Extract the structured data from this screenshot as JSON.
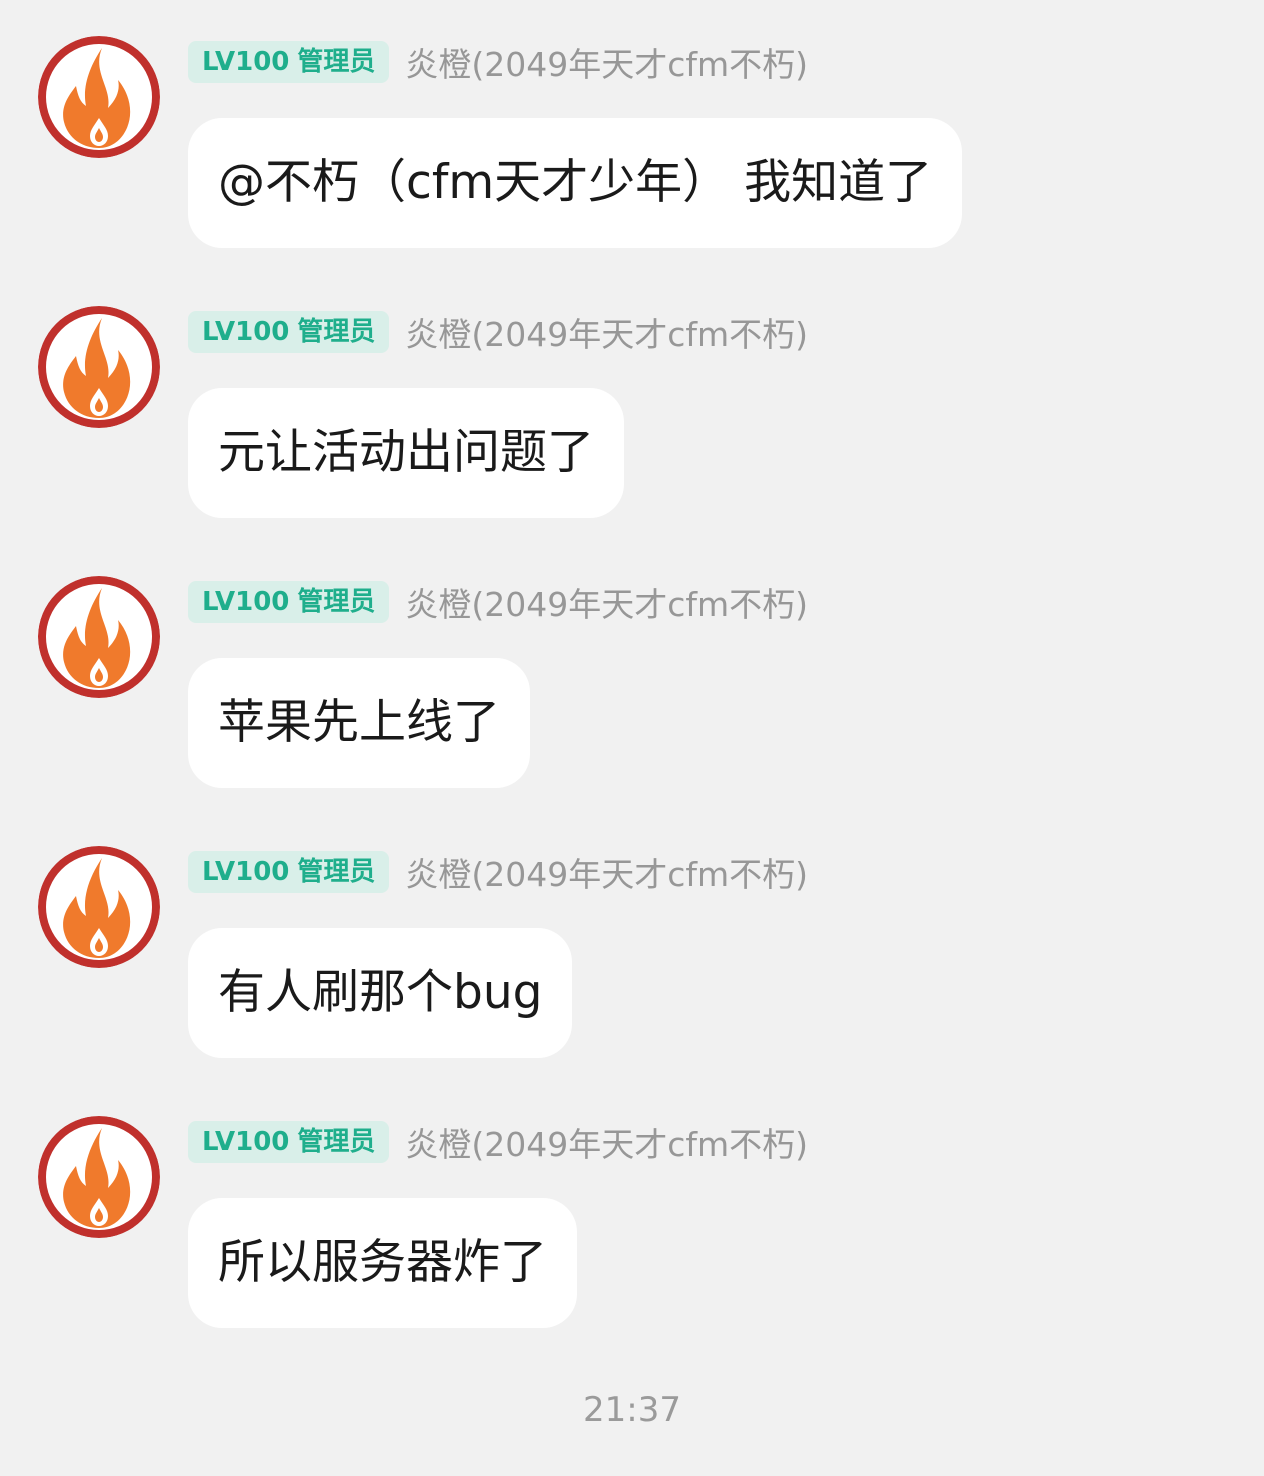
{
  "colors": {
    "background": "#f1f1f1",
    "bubble": "#ffffff",
    "badge_bg": "#d9efe9",
    "badge_text": "#1fae8c",
    "sender_text": "#979797",
    "avatar_ring": "#c0302c",
    "avatar_flame": "#f07a2c"
  },
  "messages": [
    {
      "avatar_icon": "flame-avatar-icon",
      "badge": {
        "level": "LV100",
        "role": "管理员"
      },
      "sender": "炎橙(2049年天才cfm不朽)",
      "text": "@不朽（cfm天才少年） 我知道了"
    },
    {
      "avatar_icon": "flame-avatar-icon",
      "badge": {
        "level": "LV100",
        "role": "管理员"
      },
      "sender": "炎橙(2049年天才cfm不朽)",
      "text": "元让活动出问题了"
    },
    {
      "avatar_icon": "flame-avatar-icon",
      "badge": {
        "level": "LV100",
        "role": "管理员"
      },
      "sender": "炎橙(2049年天才cfm不朽)",
      "text": "苹果先上线了"
    },
    {
      "avatar_icon": "flame-avatar-icon",
      "badge": {
        "level": "LV100",
        "role": "管理员"
      },
      "sender": "炎橙(2049年天才cfm不朽)",
      "text": "有人刷那个bug"
    },
    {
      "avatar_icon": "flame-avatar-icon",
      "badge": {
        "level": "LV100",
        "role": "管理员"
      },
      "sender": "炎橙(2049年天才cfm不朽)",
      "text": "所以服务器炸了"
    }
  ],
  "timestamp": "21:37"
}
